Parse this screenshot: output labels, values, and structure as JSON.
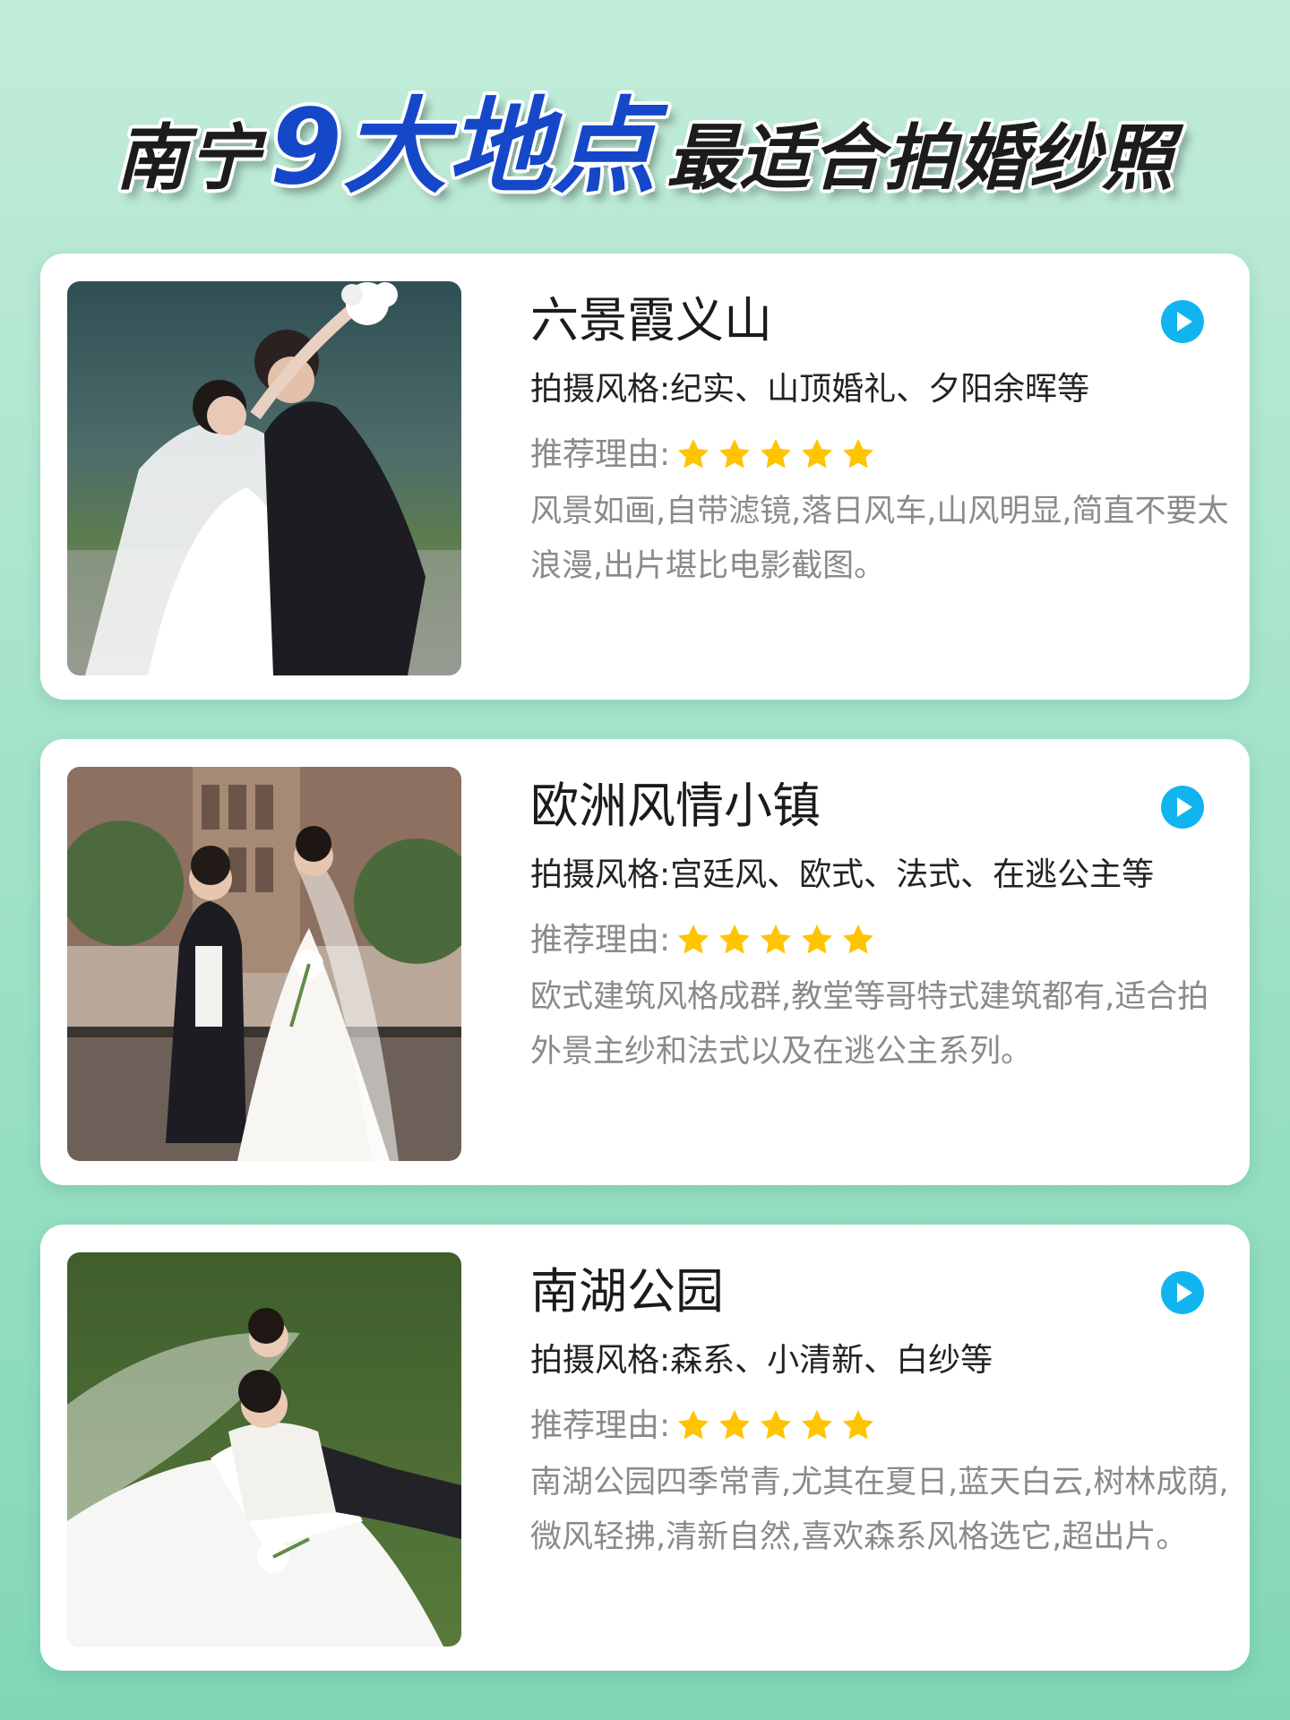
{
  "header": {
    "part1": "南宁",
    "highlight": "9大地点",
    "part2": "最适合拍婚纱照"
  },
  "colors": {
    "highlight": "#1547c9",
    "play_button": "#11b4ef",
    "star": "#ffc400"
  },
  "cards": [
    {
      "title": "六景霞义山",
      "style": "拍摄风格:纪实、山顶婚礼、夕阳余晖等",
      "reason_label": "推荐理由:",
      "rating": 5,
      "description": "风景如画,自带滤镜,落日风车,山风明显,简直不要太浪漫,出片堪比电影截图。",
      "icon": "play-icon"
    },
    {
      "title": "欧洲风情小镇",
      "style": "拍摄风格:宫廷风、欧式、法式、在逃公主等",
      "reason_label": "推荐理由:",
      "rating": 5,
      "description": "欧式建筑风格成群,教堂等哥特式建筑都有,适合拍外景主纱和法式以及在逃公主系列。",
      "icon": "play-icon"
    },
    {
      "title": "南湖公园",
      "style": "拍摄风格:森系、小清新、白纱等",
      "reason_label": "推荐理由:",
      "rating": 5,
      "description": "南湖公园四季常青,尤其在夏日,蓝天白云,树林成荫,微风轻拂,清新自然,喜欢森系风格选它,超出片。",
      "icon": "play-icon"
    }
  ]
}
